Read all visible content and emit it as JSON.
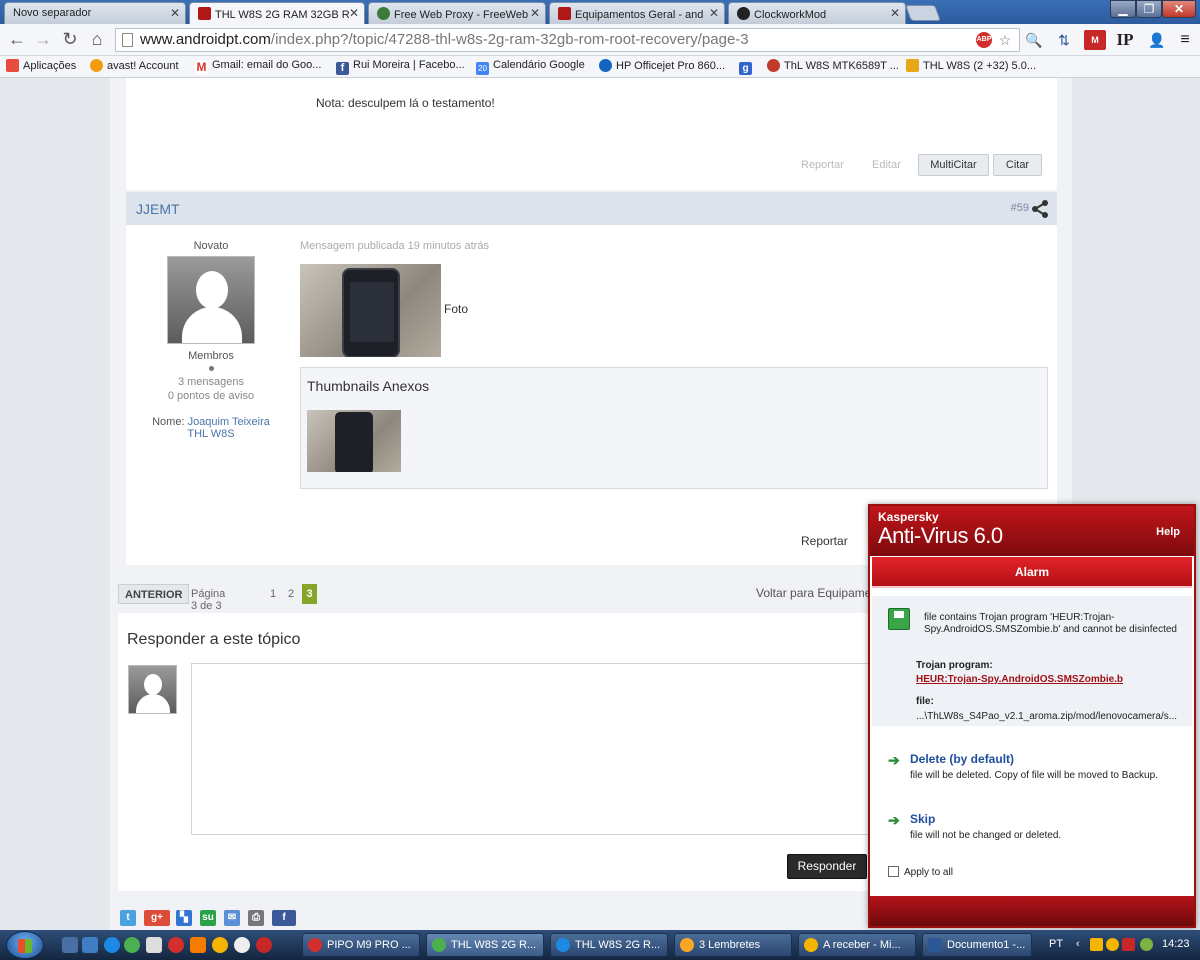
{
  "browser": {
    "tabs": [
      {
        "title": "Novo separador",
        "color": "#cfd7e2"
      },
      {
        "title": "THL W8S 2G RAM 32GB R",
        "color": "#b01818"
      },
      {
        "title": "Free Web Proxy - FreeWeb",
        "color": "#3b7a3b"
      },
      {
        "title": "Equipamentos Geral - and",
        "color": "#b01818"
      },
      {
        "title": "ClockworkMod",
        "color": "#222222"
      }
    ],
    "url_host": "www.androidpt.com",
    "url_path": "/index.php?/topic/47288-thl-w8s-2g-ram-32gb-rom-root-recovery/page-3",
    "bookmarks": [
      {
        "label": "Aplicações",
        "color": "#e84c3d"
      },
      {
        "label": "avast! Account",
        "color": "#f39c12"
      },
      {
        "label": "Gmail: email do Goo...",
        "color": "#d9332a"
      },
      {
        "label": "Rui Moreira | Facebo...",
        "color": "#3b5998"
      },
      {
        "label": "Calendário Google",
        "color": "#4285f4"
      },
      {
        "label": "HP Officejet Pro 860...",
        "color": "#1565c0"
      },
      {
        "label": "ThL W8S MTK6589T ...",
        "color": "#c0392b"
      },
      {
        "label": "THL W8S (2 +32) 5.0...",
        "color": "#e6a817"
      }
    ],
    "extra_bookmark_icon_color": "#3366cc"
  },
  "post_prev": {
    "note": "Nota: desculpem lá o testamento!",
    "reportar": "Reportar",
    "editar": "Editar",
    "multicitar": "MultiCitar",
    "citar": "Citar"
  },
  "post": {
    "author": "JJEMT",
    "number": "#59",
    "rank": "Novato",
    "group": "Membros",
    "messages": "3 mensagens",
    "warnings": "0 pontos de aviso",
    "name_label": "Nome:",
    "name_value": "Joaquim Teixeira",
    "device": "THL W8S",
    "published": "Mensagem publicada 19 minutos atrás",
    "photo_caption": "Foto",
    "thumbs_title": "Thumbnails Anexos",
    "reportar": "Reportar"
  },
  "pagination": {
    "anterior": "ANTERIOR",
    "info": "Página 3 de 3",
    "p1": "1",
    "p2": "2",
    "p3": "3",
    "back": "Voltar para Equipame"
  },
  "reply": {
    "title": "Responder a este tópico",
    "button": "Responder"
  },
  "kaspersky": {
    "brand": "Kaspersky",
    "product": "Anti-Virus 6.0",
    "help": "Help",
    "alarm": "Alarm",
    "message": "file contains Trojan program 'HEUR:Trojan-Spy.AndroidOS.SMSZombie.b' and cannot be disinfected",
    "trojan_label": "Trojan program:",
    "trojan_name": "HEUR:Trojan-Spy.AndroidOS.SMSZombie.b",
    "file_label": "file:",
    "file_path": "...\\ThLW8s_S4Pao_v2.1_aroma.zip/mod/lenovocamera/s...",
    "delete_title": "Delete (by default)",
    "delete_desc": "file will be deleted. Copy of file will be moved to Backup.",
    "skip_title": "Skip",
    "skip_desc": "file will not be changed or deleted.",
    "apply_all": "Apply to all"
  },
  "taskbar": {
    "items": [
      {
        "label": "PIPO M9 PRO ...",
        "color": "#d32f2f"
      },
      {
        "label": "THL W8S 2G R...",
        "color": "#4caf50"
      },
      {
        "label": "THL W8S 2G R...",
        "color": "#1e88e5"
      },
      {
        "label": "3 Lembretes",
        "color": "#f9a825"
      },
      {
        "label": "A receber - Mi...",
        "color": "#f4b400"
      },
      {
        "label": "Documento1 -...",
        "color": "#2b5797"
      }
    ],
    "language": "PT",
    "time": "14:23"
  }
}
